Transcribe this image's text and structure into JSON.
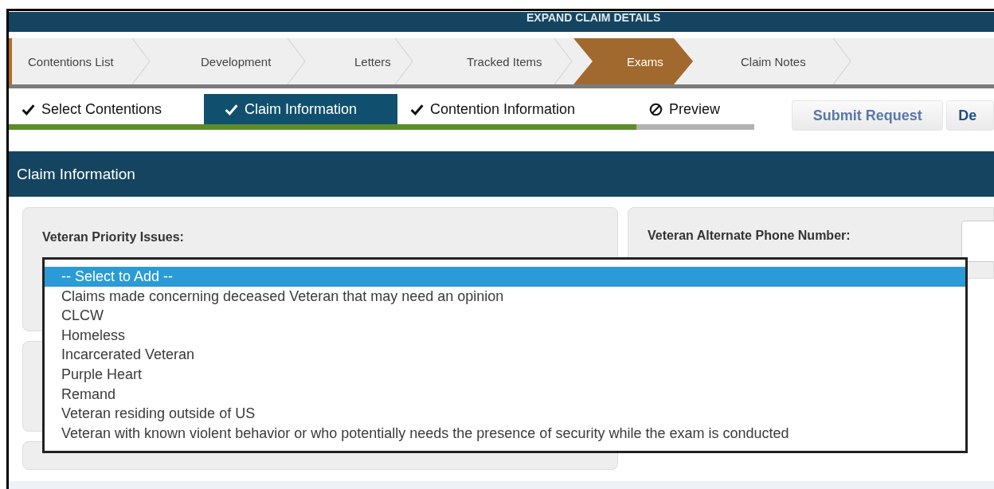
{
  "header": {
    "title": "EXPAND CLAIM DETAILS"
  },
  "breadcrumbs": [
    {
      "label": "Contentions List",
      "selected": false
    },
    {
      "label": "Development",
      "selected": false
    },
    {
      "label": "Letters",
      "selected": false
    },
    {
      "label": "Tracked Items",
      "selected": false
    },
    {
      "label": "Exams",
      "selected": true
    },
    {
      "label": "Claim Notes",
      "selected": false
    }
  ],
  "steps": [
    {
      "label": "Select Contentions",
      "done": true,
      "selected": false
    },
    {
      "label": "Claim Information",
      "done": true,
      "selected": true
    },
    {
      "label": "Contention Information",
      "done": true,
      "selected": false
    },
    {
      "label": "Preview",
      "done": false,
      "selected": false
    }
  ],
  "buttons": [
    "Submit Request",
    "De"
  ],
  "section": {
    "title": "Claim Information"
  },
  "priority_issues": {
    "label": "Veteran Priority Issues:",
    "options": [
      {
        "label": "-- Select to Add --",
        "selected": true
      },
      {
        "label": "Claims made concerning deceased Veteran that may need an opinion",
        "selected": false
      },
      {
        "label": "CLCW",
        "selected": false
      },
      {
        "label": "Homeless",
        "selected": false
      },
      {
        "label": "Incarcerated Veteran",
        "selected": false
      },
      {
        "label": "Purple Heart",
        "selected": false
      },
      {
        "label": "Remand",
        "selected": false
      },
      {
        "label": "Veteran residing outside of US",
        "selected": false
      },
      {
        "label": "Veteran with known violent behavior or who potentially needs the presence of security while the exam is conducted",
        "selected": false
      }
    ]
  },
  "alternate_phone": {
    "label": "Veteran Alternate Phone Number:"
  }
}
